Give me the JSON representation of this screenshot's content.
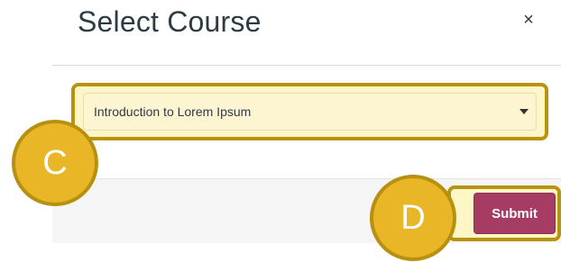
{
  "modal": {
    "title": "Select Course",
    "close_glyph": "×",
    "close_icon": "close-icon"
  },
  "course_select": {
    "selected_value": "Introduction to Lorem Ipsum",
    "caret_icon": "caret-down-icon"
  },
  "footer": {
    "submit_label": "Submit"
  },
  "callouts": {
    "c_label": "C",
    "d_label": "D"
  },
  "colors": {
    "title_text": "#2d3b45",
    "submit_background": "#a63c63",
    "callout_fill": "#e8b627",
    "callout_border": "#b7900f",
    "highlight_fill": "#fff6c8",
    "footer_background": "#f5f5f5"
  }
}
